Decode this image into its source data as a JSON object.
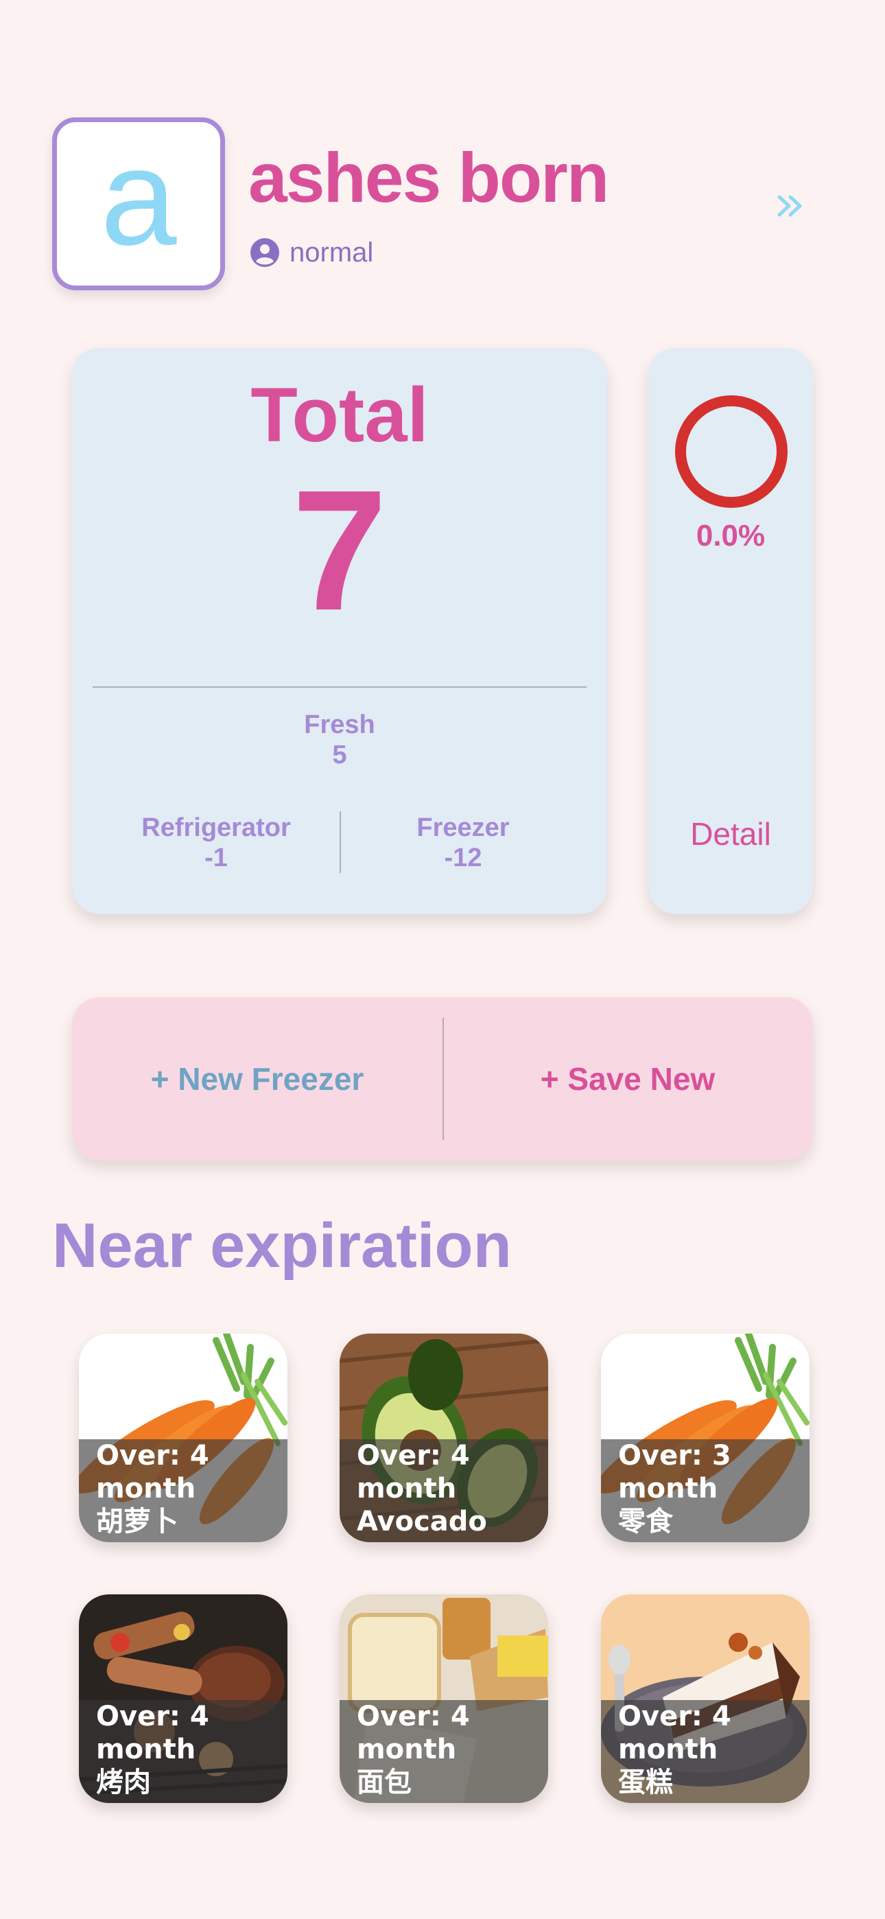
{
  "profile": {
    "avatar_letter": "a",
    "name": "ashes born",
    "role": "normal",
    "user_icon": "user-circle-icon",
    "forward_icon": "double-chevron-right-icon"
  },
  "summary": {
    "title": "Total",
    "total": "7",
    "fresh_label": "Fresh",
    "fresh_value": "5",
    "refrigerator_label": "Refrigerator",
    "refrigerator_value": "-1",
    "freezer_label": "Freezer",
    "freezer_value": "-12"
  },
  "progress": {
    "percent_text": "0.0%",
    "percent_value": 0.0,
    "detail_label": "Detail",
    "ring_color": "#d4302e"
  },
  "actions": {
    "new_freezer_label": "+ New Freezer",
    "save_new_label": "+ Save New"
  },
  "near_expiration": {
    "title": "Near expiration",
    "items": [
      {
        "line1": "Over: 4",
        "line2": "month",
        "name": "胡萝卜",
        "image": "carrot"
      },
      {
        "line1": "Over: 4",
        "line2": "month",
        "name": "Avocado",
        "image": "avocado"
      },
      {
        "line1": "Over: 3",
        "line2": "month",
        "name": "零食",
        "image": "carrot"
      },
      {
        "line1": "Over: 4",
        "line2": "month",
        "name": "烤肉",
        "image": "bbq"
      },
      {
        "line1": "Over: 4",
        "line2": "month",
        "name": "面包",
        "image": "bread"
      },
      {
        "line1": "Over: 4",
        "line2": "month",
        "name": "蛋糕",
        "image": "cake"
      }
    ]
  },
  "colors": {
    "background": "#fcf2f1",
    "brand_pink": "#d9509a",
    "brand_purple": "#a58ad6",
    "card_blue": "#e1ecf4",
    "card_pink": "#f8d9e3",
    "accent_blue": "#8fd8f5"
  }
}
